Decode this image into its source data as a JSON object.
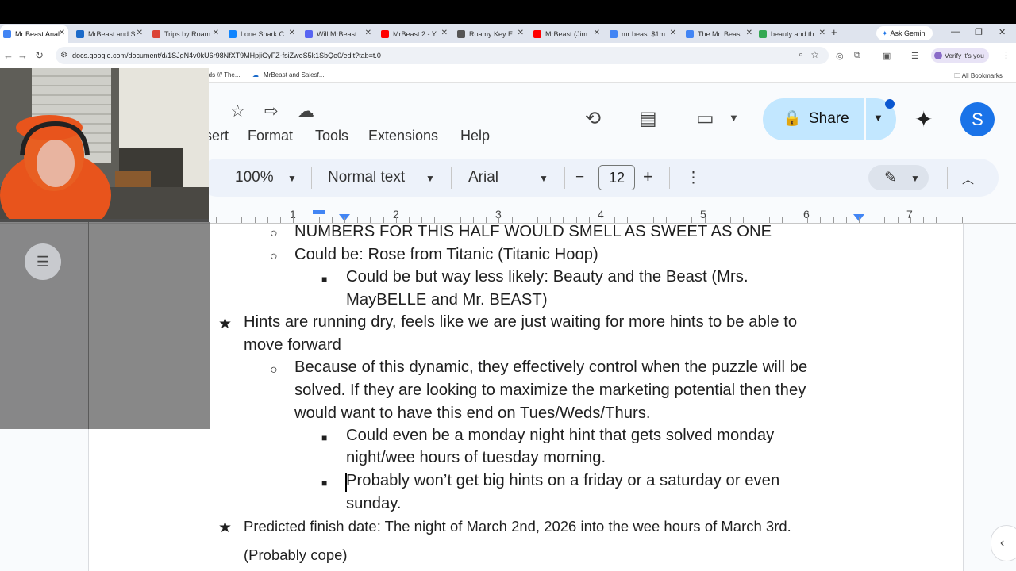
{
  "browser": {
    "tabs": [
      {
        "label": "Mr Beast Anal",
        "color": "#4285f4",
        "active": true
      },
      {
        "label": "MrBeast and S",
        "color": "#1b6ac9"
      },
      {
        "label": "Trips by Roam",
        "color": "#db4437"
      },
      {
        "label": "Lone Shark C",
        "color": "#1185fe"
      },
      {
        "label": "Will MrBeast",
        "color": "#5865f2"
      },
      {
        "label": "MrBeast 2 - Y",
        "color": "#ff0000"
      },
      {
        "label": "Roamy Key E",
        "color": "#555555"
      },
      {
        "label": "MrBeast (Jim",
        "color": "#ff0000"
      },
      {
        "label": "mr beast $1m",
        "color": "#4285f4"
      },
      {
        "label": "The Mr. Beas",
        "color": "#4285f4"
      },
      {
        "label": "beauty and th",
        "color": "#34a853"
      }
    ],
    "new_tab": "+",
    "ask_gemini": "Ask Gemini",
    "url": "docs.google.com/document/d/1SJgN4v0kU6r98NfXT9MHpjiGyFZ-fsiZweS5k1SbQe0/edit?tab=t.0",
    "verify_label": "Verify it's you",
    "bookmarks": [
      "rds /// The...",
      "MrBeast and Salesf..."
    ],
    "all_bookmarks": "All Bookmarks"
  },
  "docs": {
    "menus": [
      "sert",
      "Format",
      "Tools",
      "Extensions",
      "Help"
    ],
    "share_label": "Share",
    "avatar_letter": "S",
    "toolbar": {
      "zoom": "100%",
      "style": "Normal text",
      "font": "Arial",
      "minus": "−",
      "font_size": "12",
      "plus": "+"
    },
    "ruler_numbers": [
      "1",
      "2",
      "3",
      "4",
      "5",
      "6",
      "7"
    ]
  },
  "content": {
    "lines": [
      "NUMBERS FOR THIS HALF WOULD SMELL AS SWEET AS ONE",
      "Could be: Rose from Titanic (Titanic Hoop)",
      "Could be but way less likely: Beauty and the Beast (Mrs.",
      "MayBELLE and Mr. BEAST)",
      "Hints are running dry, feels like we are just waiting for more hints to be able to",
      "move forward",
      "Because of this dynamic, they effectively control when the puzzle will be",
      "solved. If they are looking to maximize the marketing potential then they",
      "would want to have this end on Tues/Weds/Thurs.",
      "Could even be a monday night hint that gets solved monday",
      "night/wee hours of tuesday morning.",
      "Probably won’t get big hints on a friday or a saturday or even",
      "sunday.",
      "Predicted finish date: The night of March 2nd, 2026 into the wee hours of March 3rd.",
      "(Probably cope)"
    ]
  }
}
